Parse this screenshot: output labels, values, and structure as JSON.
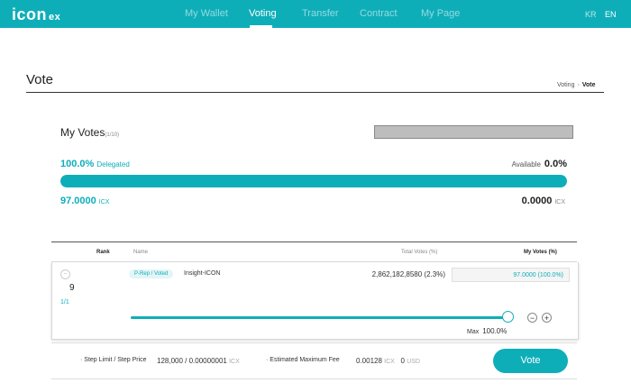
{
  "header": {
    "logo_main": "icon",
    "logo_suffix": "ex",
    "nav": [
      "My Wallet",
      "Voting",
      "Transfer",
      "Contract",
      "My Page"
    ],
    "active_nav": "Voting",
    "languages": [
      "KR",
      "EN"
    ],
    "active_language": "EN",
    "bg_color": "#0eaeb9"
  },
  "page": {
    "title": "Vote",
    "breadcrumb": [
      "Voting",
      "Vote"
    ]
  },
  "my_votes": {
    "title": "My Votes",
    "count": "(1/10)",
    "delegated_percent": "100.0%",
    "delegated_label": "Delegated",
    "available_label": "Available",
    "available_percent": "0.0%",
    "delegated_fraction": 1.0,
    "delegated_icx": "97.0000",
    "available_icx": "0.0000",
    "unit": "ICX"
  },
  "table": {
    "headers": {
      "rank": "Rank",
      "name": "Name",
      "total_votes": "Total Votes (%)",
      "my_votes": "My Votes (%)"
    },
    "row": {
      "rank": "9",
      "page": "1/1",
      "tag": "P-Rep / Voted",
      "name": "Insight-ICON",
      "total_votes": "2,862,182,8580 (2.3%)",
      "my_votes": "97.0000 (100.0%)",
      "slider_fraction": 1.0,
      "max_label": "Max",
      "max_value": "100.0%"
    }
  },
  "footer": {
    "step_label": "· Step Limit / Step Price",
    "step_limit": "128,000",
    "step_price": "0.00000001",
    "step_unit": "ICX",
    "fee_label": "· Estimated Maximum Fee",
    "fee_icx": "0.00128",
    "fee_icx_unit": "ICX",
    "fee_usd": "0",
    "fee_usd_unit": "USD",
    "vote_button": "Vote"
  }
}
